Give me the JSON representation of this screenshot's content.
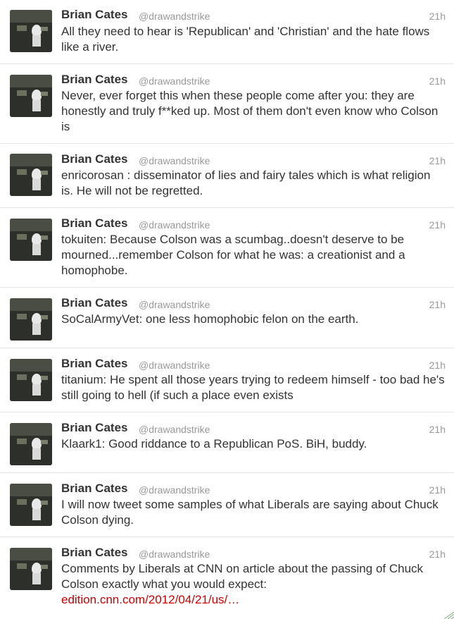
{
  "colors": {
    "name": "#333333",
    "meta": "#999999",
    "text": "#333333",
    "link": "#cc0000",
    "divider": "#e6e6e6"
  },
  "tweets": [
    {
      "name": "Brian Cates",
      "handle": "@drawandstrike",
      "time": "21h",
      "text": "All they need to hear is 'Republican' and 'Christian' and the hate flows like a river."
    },
    {
      "name": "Brian Cates",
      "handle": "@drawandstrike",
      "time": "21h",
      "text": "Never, ever forget this when these people come after you: they are honestly and truly f**ked up. Most of them don't even know who Colson is"
    },
    {
      "name": "Brian Cates",
      "handle": "@drawandstrike",
      "time": "21h",
      "text": "enricorosan : disseminator of lies and fairy tales which is what religion is. He will not be regretted."
    },
    {
      "name": "Brian Cates",
      "handle": "@drawandstrike",
      "time": "21h",
      "text": "tokuiten: Because Colson was a scumbag..doesn't deserve to be mourned...remember Colson for what he was: a creationist and a homophobe."
    },
    {
      "name": "Brian Cates",
      "handle": "@drawandstrike",
      "time": "21h",
      "text": "SoCalArmyVet: one less homophobic felon on the earth."
    },
    {
      "name": "Brian Cates",
      "handle": "@drawandstrike",
      "time": "21h",
      "text": "titanium: He spent all those years trying to redeem himself - too bad he's still going to hell (if such a place even exists"
    },
    {
      "name": "Brian Cates",
      "handle": "@drawandstrike",
      "time": "21h",
      "text": "Klaark1: Good riddance to a Republican PoS. BiH, buddy."
    },
    {
      "name": "Brian Cates",
      "handle": "@drawandstrike",
      "time": "21h",
      "text": "I will now tweet some samples of what Liberals are saying about Chuck Colson dying."
    },
    {
      "name": "Brian Cates",
      "handle": "@drawandstrike",
      "time": "21h",
      "text": "Comments by Liberals at CNN on article about the passing of Chuck Colson exactly what you would expect:",
      "link": "edition.cnn.com/2012/04/21/us/…"
    }
  ]
}
